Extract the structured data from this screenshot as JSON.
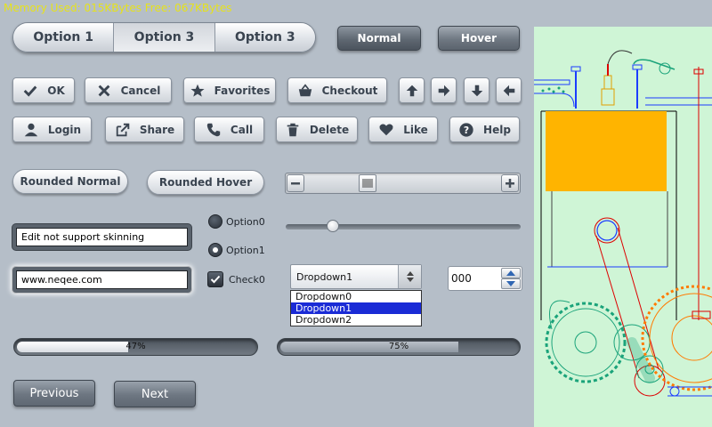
{
  "status": {
    "memory_text": "Memory Used: 015KBytes Free: 067KBytes"
  },
  "segmented": {
    "options": [
      "Option 1",
      "Option 3",
      "Option 3"
    ],
    "selected_index": 1
  },
  "top_buttons": {
    "normal": "Normal",
    "hover": "Hover"
  },
  "row1": {
    "ok": {
      "label": "OK",
      "icon": "check-icon"
    },
    "cancel": {
      "label": "Cancel",
      "icon": "x-icon"
    },
    "favorites": {
      "label": "Favorites",
      "icon": "star-icon"
    },
    "checkout": {
      "label": "Checkout",
      "icon": "basket-icon"
    },
    "arrows": [
      "arrow-up-icon",
      "arrow-right-icon",
      "arrow-down-icon",
      "arrow-left-icon"
    ]
  },
  "row2": {
    "login": {
      "label": "Login",
      "icon": "user-icon"
    },
    "share": {
      "label": "Share",
      "icon": "share-icon"
    },
    "call": {
      "label": "Call",
      "icon": "phone-icon"
    },
    "delete": {
      "label": "Delete",
      "icon": "trash-icon"
    },
    "like": {
      "label": "Like",
      "icon": "heart-icon"
    },
    "help": {
      "label": "Help",
      "icon": "question-icon"
    }
  },
  "rounded": {
    "normal": "Rounded Normal",
    "hover": "Rounded Hover"
  },
  "edits": {
    "edit1_value": "Edit not support skinning",
    "edit2_value": "www.neqee.com"
  },
  "radios": {
    "option0": "Option0",
    "option1": "Option1",
    "selected": "Option1"
  },
  "checkbox": {
    "label": "Check0",
    "checked": true
  },
  "slider": {
    "value": 0.2
  },
  "scrollbar": {
    "position": 0.3
  },
  "dropdown": {
    "selected": "Dropdown1",
    "options": [
      "Dropdown0",
      "Dropdown1",
      "Dropdown2"
    ]
  },
  "spinner": {
    "value": "000"
  },
  "progress": [
    {
      "text": "47%",
      "value": 0.47
    },
    {
      "text": "75%",
      "value": 0.75
    }
  ],
  "nav": {
    "previous": "Previous",
    "next": "Next"
  },
  "colors": {
    "memory_text": "#e6e21c",
    "background": "#b5bec8",
    "panel": "#cff5d6",
    "engine_block": "#ffb400",
    "selection": "#1a2bd6"
  }
}
